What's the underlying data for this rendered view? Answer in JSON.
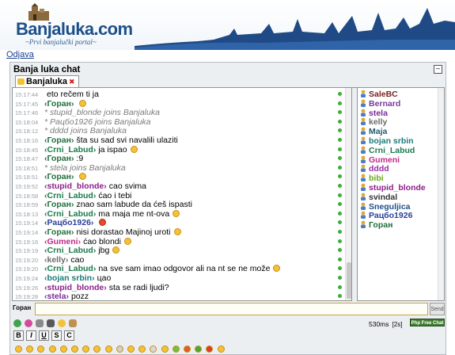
{
  "header": {
    "logo_text": "Banjaluka.com",
    "tagline": "~Prvi banjalučki portal~"
  },
  "top_link": "Odjava",
  "chat": {
    "title": "Banja luka chat",
    "room_tab": "Banjaluka",
    "input_label": "Горан",
    "input_value": "",
    "send_label": "Send",
    "latency": "530ms",
    "interval": "[2s]",
    "badge": "Php Free Chat",
    "format_buttons": [
      "B",
      "I",
      "U",
      "S",
      "C"
    ],
    "messages": [
      {
        "time": "15:17:44",
        "nick": "",
        "text": "eto rečem ti ja",
        "smiley": ""
      },
      {
        "time": "15:17:45",
        "nick": "Горан",
        "color": "#1f6e3a",
        "text": "",
        "smiley": "yellow"
      },
      {
        "time": "15:17:46",
        "join": true,
        "text": "* stupid_blonde joins Banjaluka"
      },
      {
        "time": "15:18:04",
        "join": true,
        "text": "* Рацбо1926 joins Banjaluka"
      },
      {
        "time": "15:18:12",
        "join": true,
        "text": "* dddd joins Banjaluka"
      },
      {
        "time": "15:18:16",
        "nick": "Горан",
        "color": "#1f6e3a",
        "text": "šta su sad svi navalili ulaziti",
        "smiley": ""
      },
      {
        "time": "15:18:45",
        "nick": "Crni_Labud",
        "color": "#1a7a4c",
        "text": "ja ispao",
        "smiley": "yellow"
      },
      {
        "time": "15:18:47",
        "nick": "Горан",
        "color": "#1f6e3a",
        "text": ":9",
        "smiley": ""
      },
      {
        "time": "15:18:51",
        "join": true,
        "text": "* stela joins Banjaluka"
      },
      {
        "time": "15:18:51",
        "nick": "Горан",
        "color": "#1f6e3a",
        "text": "",
        "smiley": "yellow"
      },
      {
        "time": "15:19:52",
        "nick": "stupid_blonde",
        "color": "#8a1f8a",
        "text": "cao svima",
        "smiley": ""
      },
      {
        "time": "15:18:58",
        "nick": "Crni_Labud",
        "color": "#1a7a4c",
        "text": "ćao i tebi",
        "smiley": ""
      },
      {
        "time": "15:18:59",
        "nick": "Горан",
        "color": "#1f6e3a",
        "text": "znao sam labude da ćeš ispasti",
        "smiley": ""
      },
      {
        "time": "15:18:13",
        "nick": "Crni_Labud",
        "color": "#1a7a4c",
        "text": "ma maja me nt-ova",
        "smiley": "yellow"
      },
      {
        "time": "15:19:14",
        "nick": "Рацбо1926",
        "color": "#2b3e9a",
        "text": "",
        "smiley": "red"
      },
      {
        "time": "15:19:14",
        "nick": "Горан",
        "color": "#1f6e3a",
        "text": "nisi dorastao Majinoj uroti",
        "smiley": "yellow"
      },
      {
        "time": "15:19:16",
        "nick": "Gumeni",
        "color": "#c02a8a",
        "text": "ćao blondi",
        "smiley": "yellow"
      },
      {
        "time": "15:19:19",
        "nick": "Crni_Labud",
        "color": "#1a7a4c",
        "text": "jbg",
        "smiley": "yellow"
      },
      {
        "time": "15:19:20",
        "nick": "kelly",
        "color": "#6a6a6a",
        "text": "cao",
        "smiley": ""
      },
      {
        "time": "15:19:20",
        "nick": "Crni_Labud",
        "color": "#1a7a4c",
        "text": "na sve sam imao odgovor ali na nt se ne može",
        "smiley": "yellow"
      },
      {
        "time": "15:19:24",
        "nick": "bojan srbin",
        "color": "#1b7a7a",
        "text": "цао",
        "smiley": ""
      },
      {
        "time": "15:19:26",
        "nick": "stupid_blonde",
        "color": "#8a1f8a",
        "text": "sta se radi ljudi?",
        "smiley": ""
      },
      {
        "time": "15:19:28",
        "nick": "stela",
        "color": "#7a2a9a",
        "text": "pozz",
        "smiley": ""
      }
    ],
    "users": [
      {
        "name": "SaleBC",
        "color": "#7a1f1f"
      },
      {
        "name": "Bernard",
        "color": "#7a3a9a"
      },
      {
        "name": "stela",
        "color": "#7a2a9a"
      },
      {
        "name": "kelly",
        "color": "#6a6a6a"
      },
      {
        "name": "Maja",
        "color": "#1f5a6e"
      },
      {
        "name": "bojan srbin",
        "color": "#1b7a7a"
      },
      {
        "name": "Crni_Labud",
        "color": "#1a7a4c"
      },
      {
        "name": "Gumeni",
        "color": "#c02a8a"
      },
      {
        "name": "dddd",
        "color": "#9a2ab0"
      },
      {
        "name": "bibi",
        "color": "#6aa81a"
      },
      {
        "name": "stupid_blonde",
        "color": "#8a1f8a"
      },
      {
        "name": "svindal",
        "color": "#333333"
      },
      {
        "name": "Snegulj­ica",
        "color": "#1f4f8a"
      },
      {
        "name": "Рацбо1926",
        "color": "#2b3e9a"
      },
      {
        "name": "Горан",
        "color": "#1f6e3a"
      }
    ]
  }
}
